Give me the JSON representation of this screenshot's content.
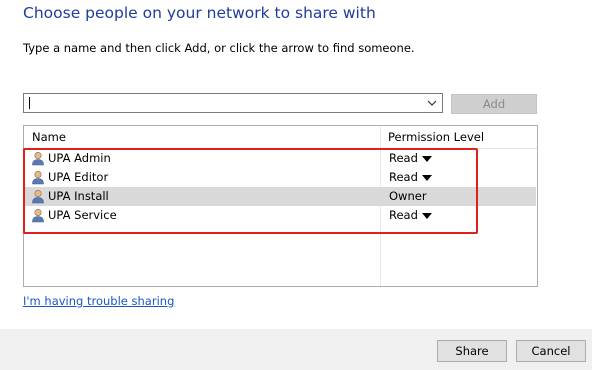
{
  "dialog": {
    "title": "Choose people on your network to share with",
    "instructions": "Type a name and then click Add, or click the arrow to find someone."
  },
  "name_input": {
    "value": "",
    "placeholder": ""
  },
  "add_button": {
    "label": "Add",
    "enabled": false
  },
  "list": {
    "columns": {
      "name": "Name",
      "permission": "Permission Level"
    },
    "rows": [
      {
        "name": "UPA Admin",
        "permission": "Read",
        "has_dropdown": true,
        "selected": false
      },
      {
        "name": "UPA Editor",
        "permission": "Read",
        "has_dropdown": true,
        "selected": false
      },
      {
        "name": "UPA Install",
        "permission": "Owner",
        "has_dropdown": false,
        "selected": true
      },
      {
        "name": "UPA Service",
        "permission": "Read",
        "has_dropdown": true,
        "selected": false
      }
    ]
  },
  "trouble_link": "I'm having trouble sharing",
  "footer": {
    "share_label": "Share",
    "cancel_label": "Cancel"
  },
  "colors": {
    "title": "#1f3d9a",
    "link": "#1a56c4",
    "highlight_box": "#e0201d",
    "selected_row": "#d9d9d9"
  },
  "icons": {
    "user": "user-icon",
    "combo_arrow": "chevron-down-icon",
    "permission_arrow": "dropdown-triangle-icon"
  }
}
